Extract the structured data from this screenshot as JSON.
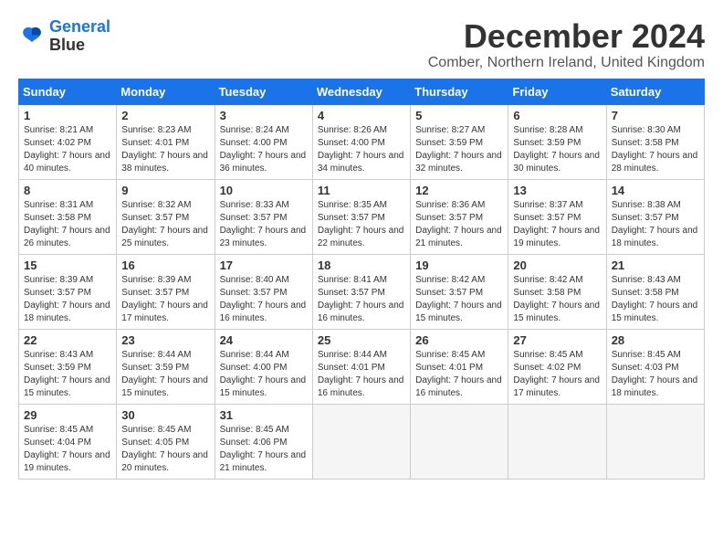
{
  "logo": {
    "line1": "General",
    "line2": "Blue"
  },
  "title": "December 2024",
  "location": "Comber, Northern Ireland, United Kingdom",
  "weekdays": [
    "Sunday",
    "Monday",
    "Tuesday",
    "Wednesday",
    "Thursday",
    "Friday",
    "Saturday"
  ],
  "weeks": [
    [
      {
        "day": "1",
        "sunrise": "8:21 AM",
        "sunset": "4:02 PM",
        "daylight": "7 hours and 40 minutes."
      },
      {
        "day": "2",
        "sunrise": "8:23 AM",
        "sunset": "4:01 PM",
        "daylight": "7 hours and 38 minutes."
      },
      {
        "day": "3",
        "sunrise": "8:24 AM",
        "sunset": "4:00 PM",
        "daylight": "7 hours and 36 minutes."
      },
      {
        "day": "4",
        "sunrise": "8:26 AM",
        "sunset": "4:00 PM",
        "daylight": "7 hours and 34 minutes."
      },
      {
        "day": "5",
        "sunrise": "8:27 AM",
        "sunset": "3:59 PM",
        "daylight": "7 hours and 32 minutes."
      },
      {
        "day": "6",
        "sunrise": "8:28 AM",
        "sunset": "3:59 PM",
        "daylight": "7 hours and 30 minutes."
      },
      {
        "day": "7",
        "sunrise": "8:30 AM",
        "sunset": "3:58 PM",
        "daylight": "7 hours and 28 minutes."
      }
    ],
    [
      {
        "day": "8",
        "sunrise": "8:31 AM",
        "sunset": "3:58 PM",
        "daylight": "7 hours and 26 minutes."
      },
      {
        "day": "9",
        "sunrise": "8:32 AM",
        "sunset": "3:57 PM",
        "daylight": "7 hours and 25 minutes."
      },
      {
        "day": "10",
        "sunrise": "8:33 AM",
        "sunset": "3:57 PM",
        "daylight": "7 hours and 23 minutes."
      },
      {
        "day": "11",
        "sunrise": "8:35 AM",
        "sunset": "3:57 PM",
        "daylight": "7 hours and 22 minutes."
      },
      {
        "day": "12",
        "sunrise": "8:36 AM",
        "sunset": "3:57 PM",
        "daylight": "7 hours and 21 minutes."
      },
      {
        "day": "13",
        "sunrise": "8:37 AM",
        "sunset": "3:57 PM",
        "daylight": "7 hours and 19 minutes."
      },
      {
        "day": "14",
        "sunrise": "8:38 AM",
        "sunset": "3:57 PM",
        "daylight": "7 hours and 18 minutes."
      }
    ],
    [
      {
        "day": "15",
        "sunrise": "8:39 AM",
        "sunset": "3:57 PM",
        "daylight": "7 hours and 18 minutes."
      },
      {
        "day": "16",
        "sunrise": "8:39 AM",
        "sunset": "3:57 PM",
        "daylight": "7 hours and 17 minutes."
      },
      {
        "day": "17",
        "sunrise": "8:40 AM",
        "sunset": "3:57 PM",
        "daylight": "7 hours and 16 minutes."
      },
      {
        "day": "18",
        "sunrise": "8:41 AM",
        "sunset": "3:57 PM",
        "daylight": "7 hours and 16 minutes."
      },
      {
        "day": "19",
        "sunrise": "8:42 AM",
        "sunset": "3:57 PM",
        "daylight": "7 hours and 15 minutes."
      },
      {
        "day": "20",
        "sunrise": "8:42 AM",
        "sunset": "3:58 PM",
        "daylight": "7 hours and 15 minutes."
      },
      {
        "day": "21",
        "sunrise": "8:43 AM",
        "sunset": "3:58 PM",
        "daylight": "7 hours and 15 minutes."
      }
    ],
    [
      {
        "day": "22",
        "sunrise": "8:43 AM",
        "sunset": "3:59 PM",
        "daylight": "7 hours and 15 minutes."
      },
      {
        "day": "23",
        "sunrise": "8:44 AM",
        "sunset": "3:59 PM",
        "daylight": "7 hours and 15 minutes."
      },
      {
        "day": "24",
        "sunrise": "8:44 AM",
        "sunset": "4:00 PM",
        "daylight": "7 hours and 15 minutes."
      },
      {
        "day": "25",
        "sunrise": "8:44 AM",
        "sunset": "4:01 PM",
        "daylight": "7 hours and 16 minutes."
      },
      {
        "day": "26",
        "sunrise": "8:45 AM",
        "sunset": "4:01 PM",
        "daylight": "7 hours and 16 minutes."
      },
      {
        "day": "27",
        "sunrise": "8:45 AM",
        "sunset": "4:02 PM",
        "daylight": "7 hours and 17 minutes."
      },
      {
        "day": "28",
        "sunrise": "8:45 AM",
        "sunset": "4:03 PM",
        "daylight": "7 hours and 18 minutes."
      }
    ],
    [
      {
        "day": "29",
        "sunrise": "8:45 AM",
        "sunset": "4:04 PM",
        "daylight": "7 hours and 19 minutes."
      },
      {
        "day": "30",
        "sunrise": "8:45 AM",
        "sunset": "4:05 PM",
        "daylight": "7 hours and 20 minutes."
      },
      {
        "day": "31",
        "sunrise": "8:45 AM",
        "sunset": "4:06 PM",
        "daylight": "7 hours and 21 minutes."
      },
      null,
      null,
      null,
      null
    ]
  ]
}
